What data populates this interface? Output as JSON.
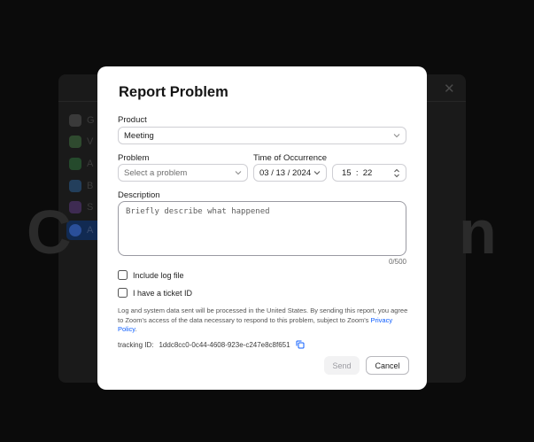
{
  "background": {
    "big_text_left": "C",
    "big_text_right": "n",
    "close_glyph": "✕",
    "sidebar": [
      {
        "label": "G",
        "color": "#5a5a5a"
      },
      {
        "label": "V",
        "color": "#3d6b3d"
      },
      {
        "label": "A",
        "color": "#2e6a3a"
      },
      {
        "label": "B",
        "color": "#2d5a86"
      },
      {
        "label": "S",
        "color": "#5b3d7a"
      },
      {
        "label": "A",
        "color": "#2f5fd0"
      }
    ]
  },
  "dialog": {
    "title": "Report Problem",
    "product": {
      "label": "Product",
      "value": "Meeting"
    },
    "problem": {
      "label": "Problem",
      "placeholder": "Select a problem"
    },
    "time_of_occurrence": {
      "label": "Time of Occurrence",
      "date": "03 / 13 / 2024",
      "time": "15  :  22"
    },
    "description": {
      "label": "Description",
      "placeholder": "Briefly describe what happened",
      "counter": "0/500"
    },
    "checkboxes": {
      "include_log": "Include log file",
      "ticket_id": "I have a ticket ID"
    },
    "disclaimer": "Log and system data sent will be processed in the United States. By sending this report, you agree to Zoom's access of the data necessary to respond to this problem, subject to Zoom's",
    "privacy_link": "Privacy Policy",
    "tracking_label": "tracking ID:",
    "tracking_id": "1ddc8cc0-0c44-4608-923e-c247e8c8f651",
    "send_label": "Send",
    "cancel_label": "Cancel"
  },
  "colors": {
    "link": "#0b5cff",
    "overlay": "#0b0b0b"
  }
}
